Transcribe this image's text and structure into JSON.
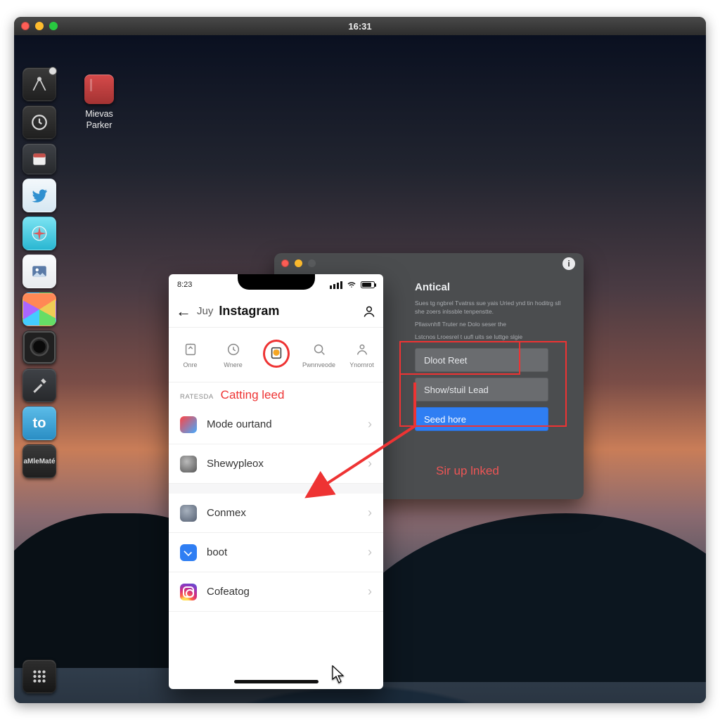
{
  "menu": {
    "time": "16:31"
  },
  "desktop_icon": {
    "line1": "Mievas",
    "line2": "Parker"
  },
  "dock": {
    "items": [
      {
        "name": "launcher-icon"
      },
      {
        "name": "clock-icon"
      },
      {
        "name": "calendar-icon"
      },
      {
        "name": "twitter-icon"
      },
      {
        "name": "safari-icon"
      },
      {
        "name": "photos-icon"
      },
      {
        "name": "colors-icon"
      },
      {
        "name": "camera-icon"
      },
      {
        "name": "screwdriver-icon"
      },
      {
        "name": "to-icon",
        "label": "to"
      },
      {
        "name": "mate-icon",
        "line1": "aMle",
        "line2": "Maté"
      },
      {
        "name": "apps-grid-icon"
      }
    ]
  },
  "phone": {
    "status_time": "8:23",
    "header_prefix": "Juy",
    "header_title": "Instagram",
    "tabs": [
      {
        "key": "open",
        "label": "Onre"
      },
      {
        "key": "where",
        "label": "Wnere"
      },
      {
        "key": "active",
        "label": ""
      },
      {
        "key": "passwords",
        "label": "Pwnnveode"
      },
      {
        "key": "accounts",
        "label": "Ynornrot"
      }
    ],
    "section_label": "RATESDA",
    "section_title": "Catting leed",
    "rows": [
      {
        "key": "mode",
        "label": "Mode ourtand"
      },
      {
        "key": "shey",
        "label": "Shewypleox"
      },
      {
        "key": "conmex",
        "label": "Conmex"
      },
      {
        "key": "boot",
        "label": "boot"
      },
      {
        "key": "cofeatog",
        "label": "Cofeatog"
      }
    ]
  },
  "panel": {
    "title": "Antical",
    "desc1": "Sues tg ngbrel Tvatrss sue yais Uried ynd tin hoditrg sll she zoers inlssble tenpenstte.",
    "desc2": "Pllasvnhfl Truter ne Dolo seser the",
    "desc3": "Lstcnos Lroesrel t uufl uits se luttge slgie",
    "buttons": [
      {
        "key": "reet",
        "label": "Dloot Reet"
      },
      {
        "key": "show",
        "label": "Show/stuil Lead"
      },
      {
        "key": "seed",
        "label": "Seed hore"
      }
    ]
  },
  "annotations": {
    "note": "Sir up lnked"
  }
}
